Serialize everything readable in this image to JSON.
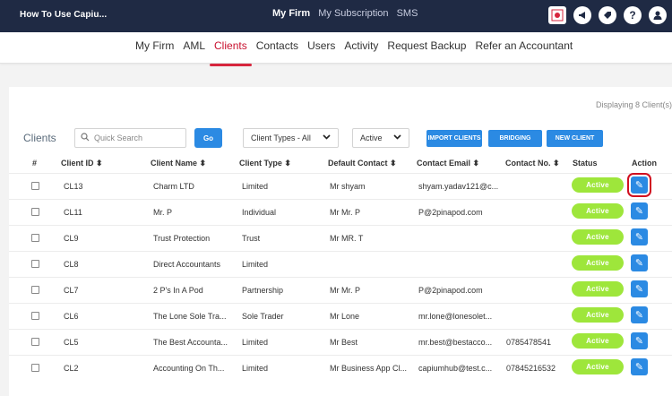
{
  "topbar": {
    "app_title": "How To Use Capiu...",
    "nav": [
      "My Firm",
      "My Subscription",
      "SMS"
    ],
    "active_nav": "My Firm",
    "icons": [
      "flag-icon",
      "megaphone-icon",
      "tag-icon",
      "help-icon",
      "user-icon"
    ]
  },
  "subnav": {
    "items": [
      "My Firm",
      "AML",
      "Clients",
      "Contacts",
      "Users",
      "Activity",
      "Request Backup",
      "Refer an Accountant"
    ],
    "active": "Clients"
  },
  "panel": {
    "displaying": "Displaying 8 Client(s)",
    "title": "Clients",
    "search_placeholder": "Quick Search",
    "go_label": "Go",
    "client_types_value": "Client Types - All",
    "status_filter_value": "Active",
    "buttons": {
      "import": "IMPORT CLIENTS",
      "bridging": "BRIDGING",
      "new_client": "NEW CLIENT"
    }
  },
  "table": {
    "headers": {
      "hash": "#",
      "client_id": "Client ID ⬍",
      "client_name": "Client Name ⬍",
      "client_type": "Client Type ⬍",
      "default_contact": "Default Contact ⬍",
      "contact_email": "Contact Email ⬍",
      "contact_no": "Contact No. ⬍",
      "status": "Status",
      "action": "Action"
    },
    "rows": [
      {
        "id": "CL13",
        "name": "Charm LTD",
        "type": "Limited",
        "contact": "Mr shyam",
        "email": "shyam.yadav121@c...",
        "phone": "",
        "status": "Active",
        "highlighted": true
      },
      {
        "id": "CL11",
        "name": "Mr. P",
        "type": "Individual",
        "contact": "Mr Mr. P",
        "email": "P@2pinapod.com",
        "phone": "",
        "status": "Active",
        "highlighted": false
      },
      {
        "id": "CL9",
        "name": "Trust Protection",
        "type": "Trust",
        "contact": "Mr MR. T",
        "email": "",
        "phone": "",
        "status": "Active",
        "highlighted": false
      },
      {
        "id": "CL8",
        "name": "Direct Accountants",
        "type": "Limited",
        "contact": "",
        "email": "",
        "phone": "",
        "status": "Active",
        "highlighted": false
      },
      {
        "id": "CL7",
        "name": "2 P's In A Pod",
        "type": "Partnership",
        "contact": "Mr Mr. P",
        "email": "P@2pinapod.com",
        "phone": "",
        "status": "Active",
        "highlighted": false
      },
      {
        "id": "CL6",
        "name": "The Lone Sole Tra...",
        "type": "Sole Trader",
        "contact": "Mr Lone",
        "email": "mr.lone@lonesolet...",
        "phone": "",
        "status": "Active",
        "highlighted": false
      },
      {
        "id": "CL5",
        "name": "The Best Accounta...",
        "type": "Limited",
        "contact": "Mr Best",
        "email": "mr.best@bestacco...",
        "phone": "0785478541",
        "status": "Active",
        "highlighted": false
      },
      {
        "id": "CL2",
        "name": "Accounting On Th...",
        "type": "Limited",
        "contact": "Mr Business App Cl...",
        "email": "capiumhub@test.c...",
        "phone": "07845216532",
        "status": "Active",
        "highlighted": false
      }
    ]
  }
}
